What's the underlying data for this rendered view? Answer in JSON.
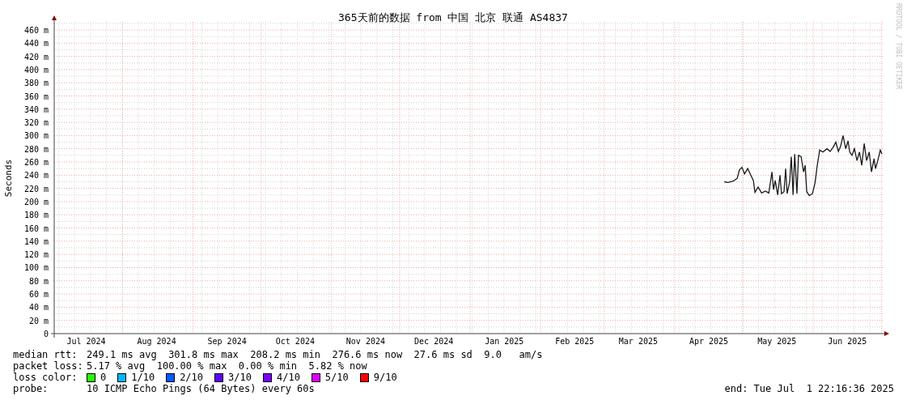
{
  "chart": {
    "credit": "RRDTOOL / TOBI OETIKER",
    "chart_data": {
      "type": "line",
      "title": "365天前的数据 from 中国 北京 联通 AS4837",
      "ylabel": "Seconds",
      "grid": true,
      "xlim": [
        "2024-07-01T22:16",
        "2025-07-01T22:16"
      ],
      "ylim": [
        0,
        472
      ],
      "xticks": [
        {
          "value": "2024-07-16T00:00",
          "label": "Jul 2024"
        },
        {
          "value": "2024-08-16T00:00",
          "label": "Aug 2024"
        },
        {
          "value": "2024-09-16T00:00",
          "label": "Sep 2024"
        },
        {
          "value": "2024-10-16T00:00",
          "label": "Oct 2024"
        },
        {
          "value": "2024-11-16T00:00",
          "label": "Nov 2024"
        },
        {
          "value": "2024-12-16T00:00",
          "label": "Dec 2024"
        },
        {
          "value": "2025-01-16T00:00",
          "label": "Jan 2025"
        },
        {
          "value": "2025-02-16T00:00",
          "label": "Feb 2025"
        },
        {
          "value": "2025-03-16T00:00",
          "label": "Mar 2025"
        },
        {
          "value": "2025-04-16T00:00",
          "label": "Apr 2025"
        },
        {
          "value": "2025-05-16T00:00",
          "label": "May 2025"
        },
        {
          "value": "2025-06-16T00:00",
          "label": "Jun 2025"
        }
      ],
      "yticks": [
        {
          "value": 0,
          "label": "0"
        },
        {
          "value": 20,
          "label": "20 m"
        },
        {
          "value": 40,
          "label": "40 m"
        },
        {
          "value": 60,
          "label": "60 m"
        },
        {
          "value": 80,
          "label": "80 m"
        },
        {
          "value": 100,
          "label": "100 m"
        },
        {
          "value": 120,
          "label": "120 m"
        },
        {
          "value": 140,
          "label": "140 m"
        },
        {
          "value": 160,
          "label": "160 m"
        },
        {
          "value": 180,
          "label": "180 m"
        },
        {
          "value": 200,
          "label": "200 m"
        },
        {
          "value": 220,
          "label": "220 m"
        },
        {
          "value": 240,
          "label": "240 m"
        },
        {
          "value": 260,
          "label": "260 m"
        },
        {
          "value": 280,
          "label": "280 m"
        },
        {
          "value": 300,
          "label": "300 m"
        },
        {
          "value": 320,
          "label": "320 m"
        },
        {
          "value": 340,
          "label": "340 m"
        },
        {
          "value": 360,
          "label": "360 m"
        },
        {
          "value": 380,
          "label": "380 m"
        },
        {
          "value": 400,
          "label": "400 m"
        },
        {
          "value": 420,
          "label": "420 m"
        },
        {
          "value": 440,
          "label": "440 m"
        },
        {
          "value": 460,
          "label": "460 m"
        }
      ],
      "x": [
        "2025-04-22T20:00",
        "2025-04-24T12:00",
        "2025-04-26T18:00",
        "2025-04-28T12:00",
        "2025-04-29T12:00",
        "2025-04-30T15:00",
        "2025-05-01T18:00",
        "2025-05-03T03:00",
        "2025-05-04T12:00",
        "2025-05-05T15:00",
        "2025-05-06T08:00",
        "2025-05-07T18:00",
        "2025-05-09T06:00",
        "2025-05-10T22:00",
        "2025-05-12T10:00",
        "2025-05-13T20:00",
        "2025-05-14T12:00",
        "2025-05-15T06:00",
        "2025-05-16T08:00",
        "2025-05-17T08:00",
        "2025-05-18T01:00",
        "2025-05-19T03:00",
        "2025-05-19T20:00",
        "2025-05-20T12:00",
        "2025-05-21T15:00",
        "2025-05-22T08:00",
        "2025-05-23T03:00",
        "2025-05-23T20:00",
        "2025-05-24T20:00",
        "2025-05-25T12:00",
        "2025-05-26T15:00",
        "2025-05-27T18:00",
        "2025-05-28T10:00",
        "2025-05-29T03:00",
        "2025-05-30T06:00",
        "2025-05-31T15:00",
        "2025-06-01T18:00",
        "2025-06-02T18:00",
        "2025-06-03T20:00",
        "2025-06-05T06:00",
        "2025-06-07T01:00",
        "2025-06-08T10:00",
        "2025-06-09T20:00",
        "2025-06-10T22:00",
        "2025-06-12T01:00",
        "2025-06-13T01:00",
        "2025-06-14T03:00",
        "2025-06-15T06:00",
        "2025-06-16T08:00",
        "2025-06-17T01:00",
        "2025-06-18T01:00",
        "2025-06-19T03:00",
        "2025-06-20T06:00",
        "2025-06-21T08:00",
        "2025-06-22T08:00",
        "2025-06-23T10:00",
        "2025-06-24T12:00",
        "2025-06-25T15:00",
        "2025-06-26T15:00",
        "2025-06-27T18:00",
        "2025-06-28T10:00",
        "2025-06-29T10:00",
        "2025-06-30T12:00",
        "2025-07-01T06:00"
      ],
      "series": [
        {
          "color": "#1a1a1a",
          "values": [
            230,
            229,
            231,
            235,
            248,
            252,
            242,
            250,
            240,
            232,
            214,
            222,
            213,
            216,
            213,
            245,
            218,
            232,
            210,
            240,
            212,
            215,
            250,
            212,
            230,
            268,
            210,
            272,
            212,
            270,
            268,
            245,
            255,
            215,
            209,
            212,
            228,
            255,
            278,
            275,
            280,
            276,
            283,
            290,
            276,
            284,
            300,
            280,
            292,
            275,
            270,
            280,
            262,
            275,
            255,
            288,
            262,
            275,
            245,
            265,
            250,
            262,
            278,
            272
          ]
        }
      ]
    }
  },
  "legend": {
    "stats": [
      {
        "label": "median rtt:",
        "text": "249.1 ms avg  301.8 ms max  208.2 ms min  276.6 ms now  27.6 ms sd  9.0   am/s"
      },
      {
        "label": "packet loss:",
        "text": "5.17 % avg  100.00 % max  0.00 % min  5.82 % now"
      }
    ],
    "loss_color": {
      "label": "loss color:",
      "items": [
        {
          "label": "0",
          "color": "#26ff00"
        },
        {
          "label": "1/10",
          "color": "#00b8ff"
        },
        {
          "label": "2/10",
          "color": "#0059ff"
        },
        {
          "label": "3/10",
          "color": "#5e00ff"
        },
        {
          "label": "4/10",
          "color": "#7e00ff"
        },
        {
          "label": "5/10",
          "color": "#dd00ff"
        },
        {
          "label": "9/10",
          "color": "#ff0000"
        }
      ]
    },
    "probe": {
      "label": "probe:",
      "text": "10 ICMP Echo Pings (64 Bytes) every 60s",
      "end": "end: Tue Jul  1 22:16:36 2025"
    }
  }
}
